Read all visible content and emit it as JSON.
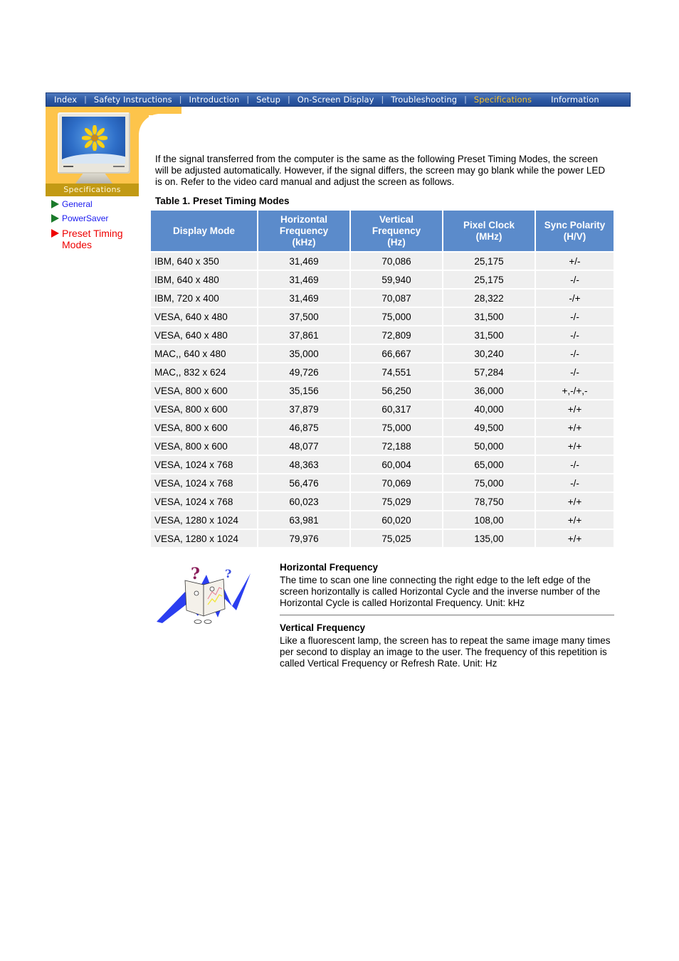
{
  "nav": {
    "items": [
      {
        "label": "Index",
        "active": false
      },
      {
        "label": "Safety Instructions",
        "active": false
      },
      {
        "label": "Introduction",
        "active": false
      },
      {
        "label": "Setup",
        "active": false
      },
      {
        "label": "On-Screen Display",
        "active": false
      },
      {
        "label": "Troubleshooting",
        "active": false
      },
      {
        "label": "Specifications",
        "active": true
      },
      {
        "label": "Information",
        "active": false
      }
    ],
    "separator": "|"
  },
  "banner": {
    "label": "Specifications"
  },
  "side_menu": {
    "items": [
      {
        "label": "General",
        "active": false
      },
      {
        "label": "PowerSaver",
        "active": false
      },
      {
        "label": "Preset Timing Modes",
        "active": true
      }
    ]
  },
  "intro": "If the signal transferred from the computer is the same as the following Preset Timing Modes, the screen will be adjusted automatically. However, if the signal differs, the screen may go blank while the power LED is on. Refer to the video card manual and adjust the screen as follows.",
  "table": {
    "caption": "Table 1. Preset Timing Modes",
    "headers": [
      [
        "Display Mode"
      ],
      [
        "Horizontal",
        "Frequency",
        "(kHz)"
      ],
      [
        "Vertical",
        "Frequency",
        "(Hz)"
      ],
      [
        "Pixel Clock",
        "(MHz)"
      ],
      [
        "Sync Polarity",
        "(H/V)"
      ]
    ],
    "rows": [
      [
        "IBM, 640 x 350",
        "31,469",
        "70,086",
        "25,175",
        "+/-"
      ],
      [
        "IBM, 640 x 480",
        "31,469",
        "59,940",
        "25,175",
        "-/-"
      ],
      [
        "IBM, 720 x 400",
        "31,469",
        "70,087",
        "28,322",
        "-/+"
      ],
      [
        "VESA, 640 x 480",
        "37,500",
        "75,000",
        "31,500",
        "-/-"
      ],
      [
        "VESA, 640 x 480",
        "37,861",
        "72,809",
        "31,500",
        "-/-"
      ],
      [
        "MAC,, 640 x 480",
        "35,000",
        "66,667",
        "30,240",
        "-/-"
      ],
      [
        "MAC,, 832 x 624",
        "49,726",
        "74,551",
        "57,284",
        "-/-"
      ],
      [
        "VESA, 800 x 600",
        "35,156",
        "56,250",
        "36,000",
        "+,-/+,-"
      ],
      [
        "VESA, 800 x 600",
        "37,879",
        "60,317",
        "40,000",
        "+/+"
      ],
      [
        "VESA, 800 x 600",
        "46,875",
        "75,000",
        "49,500",
        "+/+"
      ],
      [
        "VESA, 800 x 600",
        "48,077",
        "72,188",
        "50,000",
        "+/+"
      ],
      [
        "VESA, 1024 x 768",
        "48,363",
        "60,004",
        "65,000",
        "-/-"
      ],
      [
        "VESA, 1024 x 768",
        "56,476",
        "70,069",
        "75,000",
        "-/-"
      ],
      [
        "VESA, 1024 x 768",
        "60,023",
        "75,029",
        "78,750",
        "+/+"
      ],
      [
        "VESA, 1280 x 1024",
        "63,981",
        "60,020",
        "108,00",
        "+/+"
      ],
      [
        "VESA, 1280 x 1024",
        "79,976",
        "75,025",
        "135,00",
        "+/+"
      ]
    ]
  },
  "glossary": [
    {
      "title": "Horizontal Frequency",
      "text": "The time to scan one line connecting the right edge to the left edge of the screen horizontally is called Horizontal Cycle and the inverse number of the Horizontal Cycle is called Horizontal Frequency. Unit: kHz"
    },
    {
      "title": "Vertical Frequency",
      "text": "Like a fluorescent lamp, the screen has to repeat the same image many times per second to display an image to the user. The frequency of this repetition is called Vertical Frequency or Refresh Rate. Unit: Hz"
    }
  ],
  "colors": {
    "nav_bg": "#2d58a3",
    "nav_active": "#f7c12c",
    "banner_bg": "#fdc44b",
    "banner_label_bg": "#c29a14",
    "table_header_bg": "#5b8bcb",
    "table_row_bg": "#efefef",
    "link": "#1a1aef",
    "link_active": "#ee0000",
    "menu_arrow": "#1a7a2a"
  }
}
